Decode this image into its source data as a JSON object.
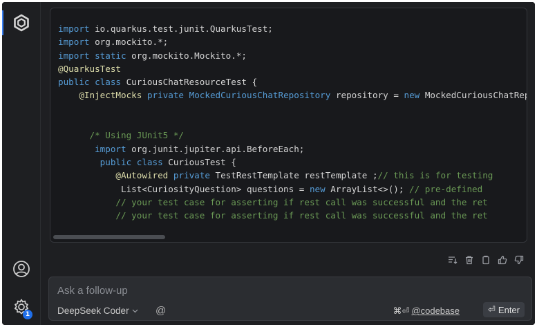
{
  "code_lines": [
    [
      {
        "c": "kw",
        "t": "import"
      },
      {
        "c": "tx",
        "t": " io.quarkus.test.junit.QuarkusTest;"
      }
    ],
    [
      {
        "c": "kw",
        "t": "import"
      },
      {
        "c": "tx",
        "t": " org.mockito.*;"
      }
    ],
    [
      {
        "c": "kw",
        "t": "import"
      },
      {
        "c": "tx",
        "t": " "
      },
      {
        "c": "kw",
        "t": "static"
      },
      {
        "c": "tx",
        "t": " org.mockito.Mockito.*;"
      }
    ],
    [
      {
        "c": "ann",
        "t": "@QuarkusTest"
      }
    ],
    [
      {
        "c": "kw",
        "t": "public class"
      },
      {
        "c": "tx",
        "t": " "
      },
      {
        "c": "cls",
        "t": "CuriousChatResourceTest"
      },
      {
        "c": "tx",
        "t": " {"
      }
    ],
    [
      {
        "c": "tx",
        "t": "    "
      },
      {
        "c": "ann",
        "t": "@InjectMocks"
      },
      {
        "c": "tx",
        "t": " "
      },
      {
        "c": "kw",
        "t": "private"
      },
      {
        "c": "tx",
        "t": " "
      },
      {
        "c": "kw",
        "t": "MockedCuriousChatRepository"
      },
      {
        "c": "tx",
        "t": " repository = "
      },
      {
        "c": "kw",
        "t": "new"
      },
      {
        "c": "tx",
        "t": " MockedCuriousChatRepository();"
      }
    ],
    [
      {
        "c": "tx",
        "t": " "
      }
    ],
    [
      {
        "c": "tx",
        "t": " "
      }
    ],
    [
      {
        "c": "tx",
        "t": "      "
      },
      {
        "c": "cm",
        "t": "/* Using JUnit5 */"
      }
    ],
    [
      {
        "c": "tx",
        "t": "       "
      },
      {
        "c": "kw",
        "t": "import"
      },
      {
        "c": "tx",
        "t": " org.junit.jupiter.api.BeforeEach;"
      }
    ],
    [
      {
        "c": "tx",
        "t": "        "
      },
      {
        "c": "kw",
        "t": "public class"
      },
      {
        "c": "tx",
        "t": " "
      },
      {
        "c": "cls",
        "t": "CuriousTest"
      },
      {
        "c": "tx",
        "t": " {"
      }
    ],
    [
      {
        "c": "tx",
        "t": "           "
      },
      {
        "c": "ann",
        "t": "@Autowired"
      },
      {
        "c": "tx",
        "t": " "
      },
      {
        "c": "kw",
        "t": "private"
      },
      {
        "c": "tx",
        "t": " TestRestTemplate restTemplate ;"
      },
      {
        "c": "cm",
        "t": "// this is for testing"
      }
    ],
    [
      {
        "c": "tx",
        "t": "            List<CuriosityQuestion> questions = "
      },
      {
        "c": "kw",
        "t": "new"
      },
      {
        "c": "tx",
        "t": " "
      },
      {
        "c": "cls",
        "t": "ArrayList"
      },
      {
        "c": "tx",
        "t": "<>(); "
      },
      {
        "c": "cm",
        "t": "// pre-defined"
      }
    ],
    [
      {
        "c": "tx",
        "t": "           "
      },
      {
        "c": "cm",
        "t": "// your test case for asserting if rest call was successful and the ret"
      }
    ],
    [
      {
        "c": "tx",
        "t": "           "
      },
      {
        "c": "cm",
        "t": "// your test case for asserting if rest call was successful and the ret"
      }
    ]
  ],
  "input": {
    "placeholder": "Ask a follow-up",
    "model": "DeepSeek Coder",
    "at_symbol": "@",
    "shortcut": "⌘⏎",
    "codebase_label": "@codebase",
    "enter_label": "Enter",
    "enter_icon": "⏎"
  },
  "activity": {
    "settings_badge": "1"
  },
  "colors": {
    "background": "#1e1f22",
    "code_bg": "#18191c",
    "keyword": "#569cd6",
    "annotation": "#dcdcaa",
    "comment": "#6a9955",
    "badge": "#1f6feb"
  },
  "icons": {
    "logo": "continue-logo-icon",
    "account": "account-icon",
    "settings": "gear-icon",
    "insert": "insert-at-cursor-icon",
    "delete": "trash-icon",
    "copy": "copy-icon",
    "like": "thumbs-up-icon",
    "dislike": "thumbs-down-icon"
  }
}
